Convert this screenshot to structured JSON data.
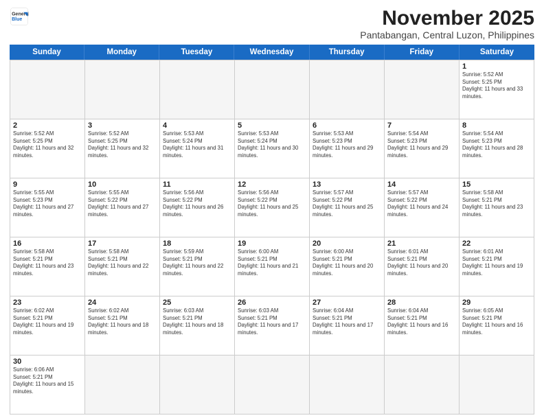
{
  "logo": {
    "line1": "General",
    "line2": "Blue"
  },
  "title": "November 2025",
  "subtitle": "Pantabangan, Central Luzon, Philippines",
  "header_days": [
    "Sunday",
    "Monday",
    "Tuesday",
    "Wednesday",
    "Thursday",
    "Friday",
    "Saturday"
  ],
  "weeks": [
    [
      {
        "day": "",
        "empty": true
      },
      {
        "day": "",
        "empty": true
      },
      {
        "day": "",
        "empty": true
      },
      {
        "day": "",
        "empty": true
      },
      {
        "day": "",
        "empty": true
      },
      {
        "day": "",
        "empty": true
      },
      {
        "day": "1",
        "rise": "5:52 AM",
        "set": "5:25 PM",
        "daylight": "11 hours and 33 minutes."
      }
    ],
    [
      {
        "day": "2",
        "rise": "5:52 AM",
        "set": "5:25 PM",
        "daylight": "11 hours and 32 minutes."
      },
      {
        "day": "3",
        "rise": "5:52 AM",
        "set": "5:25 PM",
        "daylight": "11 hours and 32 minutes."
      },
      {
        "day": "4",
        "rise": "5:53 AM",
        "set": "5:24 PM",
        "daylight": "11 hours and 31 minutes."
      },
      {
        "day": "5",
        "rise": "5:53 AM",
        "set": "5:24 PM",
        "daylight": "11 hours and 30 minutes."
      },
      {
        "day": "6",
        "rise": "5:53 AM",
        "set": "5:23 PM",
        "daylight": "11 hours and 29 minutes."
      },
      {
        "day": "7",
        "rise": "5:54 AM",
        "set": "5:23 PM",
        "daylight": "11 hours and 29 minutes."
      },
      {
        "day": "8",
        "rise": "5:54 AM",
        "set": "5:23 PM",
        "daylight": "11 hours and 28 minutes."
      }
    ],
    [
      {
        "day": "9",
        "rise": "5:55 AM",
        "set": "5:23 PM",
        "daylight": "11 hours and 27 minutes."
      },
      {
        "day": "10",
        "rise": "5:55 AM",
        "set": "5:22 PM",
        "daylight": "11 hours and 27 minutes."
      },
      {
        "day": "11",
        "rise": "5:56 AM",
        "set": "5:22 PM",
        "daylight": "11 hours and 26 minutes."
      },
      {
        "day": "12",
        "rise": "5:56 AM",
        "set": "5:22 PM",
        "daylight": "11 hours and 25 minutes."
      },
      {
        "day": "13",
        "rise": "5:57 AM",
        "set": "5:22 PM",
        "daylight": "11 hours and 25 minutes."
      },
      {
        "day": "14",
        "rise": "5:57 AM",
        "set": "5:22 PM",
        "daylight": "11 hours and 24 minutes."
      },
      {
        "day": "15",
        "rise": "5:58 AM",
        "set": "5:21 PM",
        "daylight": "11 hours and 23 minutes."
      }
    ],
    [
      {
        "day": "16",
        "rise": "5:58 AM",
        "set": "5:21 PM",
        "daylight": "11 hours and 23 minutes."
      },
      {
        "day": "17",
        "rise": "5:58 AM",
        "set": "5:21 PM",
        "daylight": "11 hours and 22 minutes."
      },
      {
        "day": "18",
        "rise": "5:59 AM",
        "set": "5:21 PM",
        "daylight": "11 hours and 22 minutes."
      },
      {
        "day": "19",
        "rise": "6:00 AM",
        "set": "5:21 PM",
        "daylight": "11 hours and 21 minutes."
      },
      {
        "day": "20",
        "rise": "6:00 AM",
        "set": "5:21 PM",
        "daylight": "11 hours and 20 minutes."
      },
      {
        "day": "21",
        "rise": "6:01 AM",
        "set": "5:21 PM",
        "daylight": "11 hours and 20 minutes."
      },
      {
        "day": "22",
        "rise": "6:01 AM",
        "set": "5:21 PM",
        "daylight": "11 hours and 19 minutes."
      }
    ],
    [
      {
        "day": "23",
        "rise": "6:02 AM",
        "set": "5:21 PM",
        "daylight": "11 hours and 19 minutes."
      },
      {
        "day": "24",
        "rise": "6:02 AM",
        "set": "5:21 PM",
        "daylight": "11 hours and 18 minutes."
      },
      {
        "day": "25",
        "rise": "6:03 AM",
        "set": "5:21 PM",
        "daylight": "11 hours and 18 minutes."
      },
      {
        "day": "26",
        "rise": "6:03 AM",
        "set": "5:21 PM",
        "daylight": "11 hours and 17 minutes."
      },
      {
        "day": "27",
        "rise": "6:04 AM",
        "set": "5:21 PM",
        "daylight": "11 hours and 17 minutes."
      },
      {
        "day": "28",
        "rise": "6:04 AM",
        "set": "5:21 PM",
        "daylight": "11 hours and 16 minutes."
      },
      {
        "day": "29",
        "rise": "6:05 AM",
        "set": "5:21 PM",
        "daylight": "11 hours and 16 minutes."
      }
    ],
    [
      {
        "day": "30",
        "rise": "6:06 AM",
        "set": "5:21 PM",
        "daylight": "11 hours and 15 minutes."
      },
      {
        "day": "",
        "empty": true
      },
      {
        "day": "",
        "empty": true
      },
      {
        "day": "",
        "empty": true
      },
      {
        "day": "",
        "empty": true
      },
      {
        "day": "",
        "empty": true
      },
      {
        "day": "",
        "empty": true
      }
    ]
  ]
}
